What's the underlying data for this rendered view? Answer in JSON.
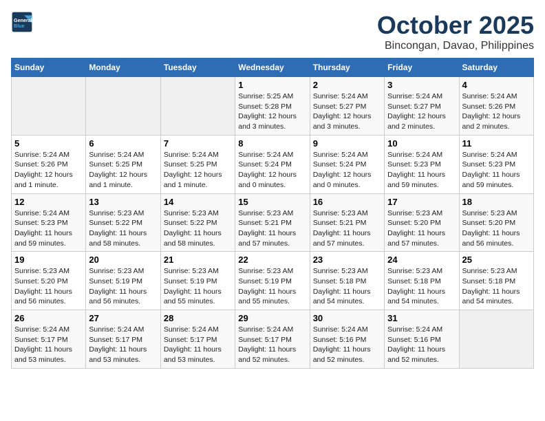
{
  "logo": {
    "line1": "General",
    "line2": "Blue"
  },
  "title": "October 2025",
  "subtitle": "Bincongan, Davao, Philippines",
  "days_of_week": [
    "Sunday",
    "Monday",
    "Tuesday",
    "Wednesday",
    "Thursday",
    "Friday",
    "Saturday"
  ],
  "weeks": [
    [
      {
        "num": "",
        "detail": ""
      },
      {
        "num": "",
        "detail": ""
      },
      {
        "num": "",
        "detail": ""
      },
      {
        "num": "1",
        "detail": "Sunrise: 5:25 AM\nSunset: 5:28 PM\nDaylight: 12 hours and 3 minutes."
      },
      {
        "num": "2",
        "detail": "Sunrise: 5:24 AM\nSunset: 5:27 PM\nDaylight: 12 hours and 3 minutes."
      },
      {
        "num": "3",
        "detail": "Sunrise: 5:24 AM\nSunset: 5:27 PM\nDaylight: 12 hours and 2 minutes."
      },
      {
        "num": "4",
        "detail": "Sunrise: 5:24 AM\nSunset: 5:26 PM\nDaylight: 12 hours and 2 minutes."
      }
    ],
    [
      {
        "num": "5",
        "detail": "Sunrise: 5:24 AM\nSunset: 5:26 PM\nDaylight: 12 hours and 1 minute."
      },
      {
        "num": "6",
        "detail": "Sunrise: 5:24 AM\nSunset: 5:25 PM\nDaylight: 12 hours and 1 minute."
      },
      {
        "num": "7",
        "detail": "Sunrise: 5:24 AM\nSunset: 5:25 PM\nDaylight: 12 hours and 1 minute."
      },
      {
        "num": "8",
        "detail": "Sunrise: 5:24 AM\nSunset: 5:24 PM\nDaylight: 12 hours and 0 minutes."
      },
      {
        "num": "9",
        "detail": "Sunrise: 5:24 AM\nSunset: 5:24 PM\nDaylight: 12 hours and 0 minutes."
      },
      {
        "num": "10",
        "detail": "Sunrise: 5:24 AM\nSunset: 5:23 PM\nDaylight: 11 hours and 59 minutes."
      },
      {
        "num": "11",
        "detail": "Sunrise: 5:24 AM\nSunset: 5:23 PM\nDaylight: 11 hours and 59 minutes."
      }
    ],
    [
      {
        "num": "12",
        "detail": "Sunrise: 5:24 AM\nSunset: 5:23 PM\nDaylight: 11 hours and 59 minutes."
      },
      {
        "num": "13",
        "detail": "Sunrise: 5:23 AM\nSunset: 5:22 PM\nDaylight: 11 hours and 58 minutes."
      },
      {
        "num": "14",
        "detail": "Sunrise: 5:23 AM\nSunset: 5:22 PM\nDaylight: 11 hours and 58 minutes."
      },
      {
        "num": "15",
        "detail": "Sunrise: 5:23 AM\nSunset: 5:21 PM\nDaylight: 11 hours and 57 minutes."
      },
      {
        "num": "16",
        "detail": "Sunrise: 5:23 AM\nSunset: 5:21 PM\nDaylight: 11 hours and 57 minutes."
      },
      {
        "num": "17",
        "detail": "Sunrise: 5:23 AM\nSunset: 5:20 PM\nDaylight: 11 hours and 57 minutes."
      },
      {
        "num": "18",
        "detail": "Sunrise: 5:23 AM\nSunset: 5:20 PM\nDaylight: 11 hours and 56 minutes."
      }
    ],
    [
      {
        "num": "19",
        "detail": "Sunrise: 5:23 AM\nSunset: 5:20 PM\nDaylight: 11 hours and 56 minutes."
      },
      {
        "num": "20",
        "detail": "Sunrise: 5:23 AM\nSunset: 5:19 PM\nDaylight: 11 hours and 56 minutes."
      },
      {
        "num": "21",
        "detail": "Sunrise: 5:23 AM\nSunset: 5:19 PM\nDaylight: 11 hours and 55 minutes."
      },
      {
        "num": "22",
        "detail": "Sunrise: 5:23 AM\nSunset: 5:19 PM\nDaylight: 11 hours and 55 minutes."
      },
      {
        "num": "23",
        "detail": "Sunrise: 5:23 AM\nSunset: 5:18 PM\nDaylight: 11 hours and 54 minutes."
      },
      {
        "num": "24",
        "detail": "Sunrise: 5:23 AM\nSunset: 5:18 PM\nDaylight: 11 hours and 54 minutes."
      },
      {
        "num": "25",
        "detail": "Sunrise: 5:23 AM\nSunset: 5:18 PM\nDaylight: 11 hours and 54 minutes."
      }
    ],
    [
      {
        "num": "26",
        "detail": "Sunrise: 5:24 AM\nSunset: 5:17 PM\nDaylight: 11 hours and 53 minutes."
      },
      {
        "num": "27",
        "detail": "Sunrise: 5:24 AM\nSunset: 5:17 PM\nDaylight: 11 hours and 53 minutes."
      },
      {
        "num": "28",
        "detail": "Sunrise: 5:24 AM\nSunset: 5:17 PM\nDaylight: 11 hours and 53 minutes."
      },
      {
        "num": "29",
        "detail": "Sunrise: 5:24 AM\nSunset: 5:17 PM\nDaylight: 11 hours and 52 minutes."
      },
      {
        "num": "30",
        "detail": "Sunrise: 5:24 AM\nSunset: 5:16 PM\nDaylight: 11 hours and 52 minutes."
      },
      {
        "num": "31",
        "detail": "Sunrise: 5:24 AM\nSunset: 5:16 PM\nDaylight: 11 hours and 52 minutes."
      },
      {
        "num": "",
        "detail": ""
      }
    ]
  ]
}
